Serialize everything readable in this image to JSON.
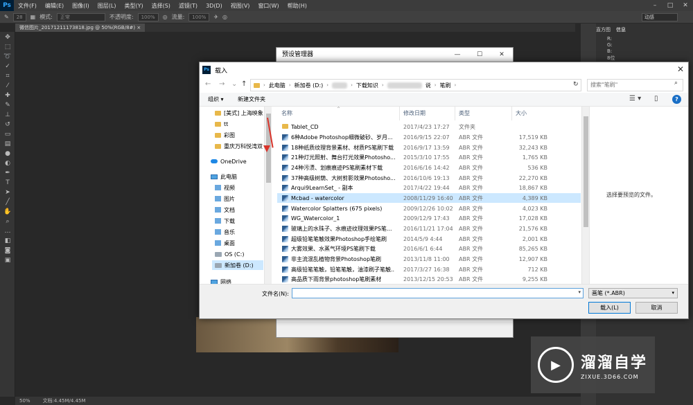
{
  "app": {
    "logo": "Ps",
    "menus": [
      "文件(F)",
      "编辑(E)",
      "图像(I)",
      "图层(L)",
      "类型(Y)",
      "选择(S)",
      "滤镜(T)",
      "3D(D)",
      "视图(V)",
      "窗口(W)",
      "帮助(H)"
    ],
    "options": {
      "mode_label": "模式:",
      "mode_value": "正常",
      "opacity_label": "不透明度:",
      "opacity_value": "100%",
      "flow_label": "流量:",
      "flow_value": "100%",
      "brush_size": "28",
      "workspace": "动感"
    },
    "doc_tab": "微信图片_20171211173818.jpg @ 50%(RGB/8#) ×",
    "right_tabs": [
      "直方图",
      "信息"
    ],
    "info_rows": [
      "R:",
      "G:",
      "B:",
      "8位",
      "X:",
      "Y:"
    ],
    "status": {
      "zoom": "50%",
      "doc": "文档:4.45M/4.45M"
    }
  },
  "preset_manager": {
    "title": "预设管理器"
  },
  "dialog": {
    "title": "载入",
    "path": [
      "此电脑",
      "新加卷 (D:)",
      "下载知识",
      "说",
      "笔刷"
    ],
    "search_placeholder": "搜索\"笔刷\"",
    "organize": "组织 ▾",
    "new_folder": "新建文件夹",
    "nav": [
      {
        "label": "[美式] 上海映象",
        "icon": "folder"
      },
      {
        "label": "tt",
        "icon": "folder"
      },
      {
        "label": "彩图",
        "icon": "folder"
      },
      {
        "label": "重庆万科悦湾双",
        "icon": "folder"
      },
      {
        "label": "OneDrive",
        "icon": "cloud"
      },
      {
        "label": "此电脑",
        "icon": "pc"
      },
      {
        "label": "视频",
        "icon": "blue"
      },
      {
        "label": "图片",
        "icon": "blue"
      },
      {
        "label": "文档",
        "icon": "blue"
      },
      {
        "label": "下载",
        "icon": "blue"
      },
      {
        "label": "音乐",
        "icon": "blue"
      },
      {
        "label": "桌面",
        "icon": "blue"
      },
      {
        "label": "OS (C:)",
        "icon": "drive"
      },
      {
        "label": "新加卷 (D:)",
        "icon": "drive"
      },
      {
        "label": "网络",
        "icon": "pc"
      }
    ],
    "columns": {
      "name": "名称",
      "date": "修改日期",
      "type": "类型",
      "size": "大小"
    },
    "files": [
      {
        "name": "Tablet_CD",
        "date": "2017/4/23 17:27",
        "type": "文件夹",
        "size": "",
        "icon": "folder"
      },
      {
        "name": "6种Adobe Photoshop细微破砂、岁月...",
        "date": "2016/9/15 22:07",
        "type": "ABR 文件",
        "size": "17,519 KB",
        "icon": "abr"
      },
      {
        "name": "18种纸质纹理背景素材、材质PS笔刷下载",
        "date": "2016/9/17 13:59",
        "type": "ABR 文件",
        "size": "32,243 KB",
        "icon": "abr"
      },
      {
        "name": "21种灯光照射、舞台打光效果Photosho...",
        "date": "2015/3/10 17:55",
        "type": "ABR 文件",
        "size": "1,765 KB",
        "icon": "abr"
      },
      {
        "name": "24种污渍、划痕痕迹PS笔刷素材下载",
        "date": "2016/6/16 14:42",
        "type": "ABR 文件",
        "size": "536 KB",
        "icon": "abr"
      },
      {
        "name": "37种高级树荫、大树剪影效果Photosho...",
        "date": "2016/10/6 19:13",
        "type": "ABR 文件",
        "size": "22,270 KB",
        "icon": "abr"
      },
      {
        "name": "Arqui9LearnSet_ - 副本",
        "date": "2017/4/22 19:44",
        "type": "ABR 文件",
        "size": "18,867 KB",
        "icon": "abr"
      },
      {
        "name": "Mcbad - watercolor",
        "date": "2008/11/29 16:40",
        "type": "ABR 文件",
        "size": "4,389 KB",
        "icon": "abr",
        "selected": true
      },
      {
        "name": "Watercolor Splatters (675 pixels)",
        "date": "2009/12/26 10:02",
        "type": "ABR 文件",
        "size": "4,023 KB",
        "icon": "abr"
      },
      {
        "name": "WG_Watercolor_1",
        "date": "2009/12/9 17:43",
        "type": "ABR 文件",
        "size": "17,028 KB",
        "icon": "abr"
      },
      {
        "name": "玻璃上的水珠子、水痕迹纹理效果PS笔...",
        "date": "2016/11/21 17:04",
        "type": "ABR 文件",
        "size": "21,576 KB",
        "icon": "abr"
      },
      {
        "name": "超级铅笔笔触效果Photoshop手绘笔刷",
        "date": "2014/5/9 4:44",
        "type": "ABR 文件",
        "size": "2,001 KB",
        "icon": "abr"
      },
      {
        "name": "大雾效果、水蒸气环境PS笔刷下载",
        "date": "2016/6/1 6:44",
        "type": "ABR 文件",
        "size": "85,265 KB",
        "icon": "abr"
      },
      {
        "name": "非主流混乱植物背景Photoshop笔刷",
        "date": "2013/11/8 11:00",
        "type": "ABR 文件",
        "size": "12,907 KB",
        "icon": "abr"
      },
      {
        "name": "高级铅笔笔触，铅笔笔触，油漆刷子笔触...",
        "date": "2017/3/27 16:38",
        "type": "ABR 文件",
        "size": "712 KB",
        "icon": "abr"
      },
      {
        "name": "高品质下雨背景photoshop笔刷素材",
        "date": "2013/12/15 20:53",
        "type": "ABR 文件",
        "size": "9,255 KB",
        "icon": "abr"
      }
    ],
    "preview_text": "选择要预览的文件。",
    "filename_label": "文件名(N):",
    "filename_value": "",
    "filetype": "画笔 (*.ABR)",
    "load_label": "载入(L)",
    "cancel_label": "取消"
  },
  "watermark": {
    "cn": "溜溜自学",
    "en": "ZIXUE.3D66.COM"
  }
}
